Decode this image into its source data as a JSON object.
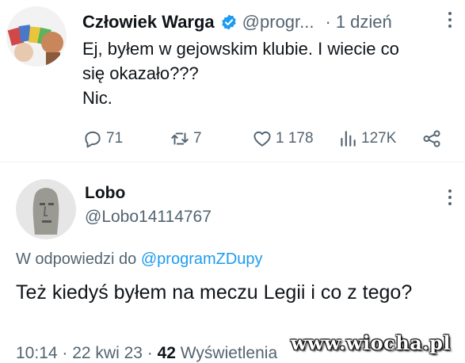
{
  "tweet": {
    "author_name": "Człowiek Warga",
    "author_handle": "@progr...",
    "separator": "·",
    "time": "1 dzień",
    "text_lines": [
      "Ej, byłem w gejowskim klubie. I wiecie co",
      "się okazało???",
      "Nic."
    ],
    "metrics": {
      "replies": "71",
      "retweets": "7",
      "likes": "1 178",
      "views": "127K"
    }
  },
  "reply": {
    "author_name": "Lobo",
    "author_handle": "@Lobo14114767",
    "reply_prefix": "W odpowiedzi do",
    "reply_target": "@programZDupy",
    "text": "Też kiedyś byłem na meczu Legii i co z tego?",
    "meta_time": "10:14 · 22 kwi 23 · ",
    "meta_views_count": "42",
    "meta_views_label": " Wyświetlenia"
  },
  "watermark": "www.wiocha.pl",
  "colors": {
    "primary_text": "#0f1419",
    "secondary_text": "#536471",
    "link": "#1d9bf0",
    "verified": "#1d9bf0"
  },
  "icons": [
    "reply-icon",
    "retweet-icon",
    "like-icon",
    "views-icon",
    "share-icon",
    "verified-icon",
    "more-icon"
  ]
}
